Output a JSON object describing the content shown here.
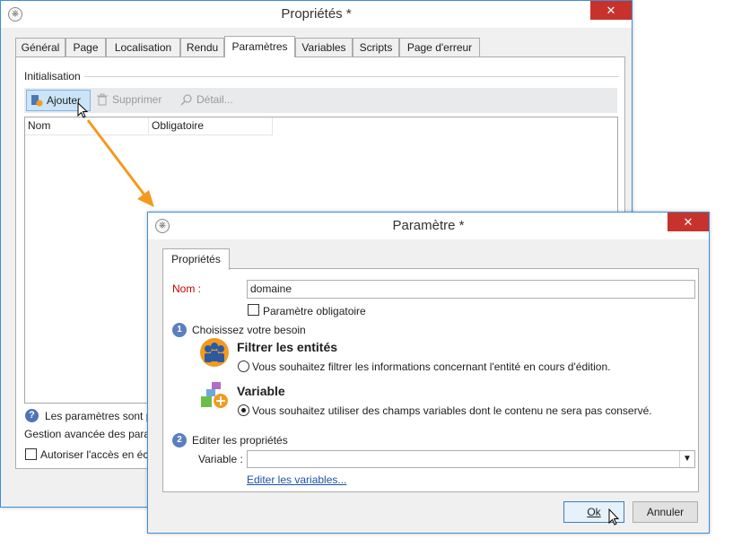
{
  "main_window": {
    "title": "Propriétés *",
    "close_label": "✕",
    "tabs": [
      {
        "label": "Général"
      },
      {
        "label": "Page"
      },
      {
        "label": "Localisation"
      },
      {
        "label": "Rendu"
      },
      {
        "label": "Paramètres"
      },
      {
        "label": "Variables"
      },
      {
        "label": "Scripts"
      },
      {
        "label": "Page d'erreur"
      }
    ],
    "active_tab": "Paramètres",
    "group_label": "Initialisation",
    "toolbar": {
      "add_label": "Ajouter",
      "delete_label": "Supprimer",
      "detail_label": "Détail..."
    },
    "list_columns": [
      "Nom",
      "Obligatoire"
    ],
    "info_text": "Les paramètres sont p",
    "advanced_text": "Gestion avancée des paran",
    "write_access_label": "Autoriser l'accès en écri"
  },
  "param_dialog": {
    "title": "Paramètre *",
    "close_label": "✕",
    "tab_label": "Propriétés",
    "name_label": "Nom :",
    "name_value": "domaine",
    "mandatory_label": "Paramètre obligatoire",
    "step1_number": "1",
    "step1_label": "Choisissez votre besoin",
    "option1_title": "Filtrer les entités",
    "option1_text": "Vous souhaitez filtrer les informations concernant l'entité en cours d'édition.",
    "option2_title": "Variable",
    "option2_text": "Vous souhaitez utiliser des champs variables dont le contenu ne sera pas conservé.",
    "step2_number": "2",
    "step2_label": "Editer les propriétés",
    "variable_label": "Variable :",
    "variable_value": "",
    "edit_variables_link": "Editer les variables...",
    "ok_label": "Ok",
    "cancel_label": "Annuler"
  },
  "colors": {
    "accent": "#3c8fd8",
    "close": "#c7332c",
    "arrow": "#f39a1e",
    "required_label": "#c00000"
  }
}
